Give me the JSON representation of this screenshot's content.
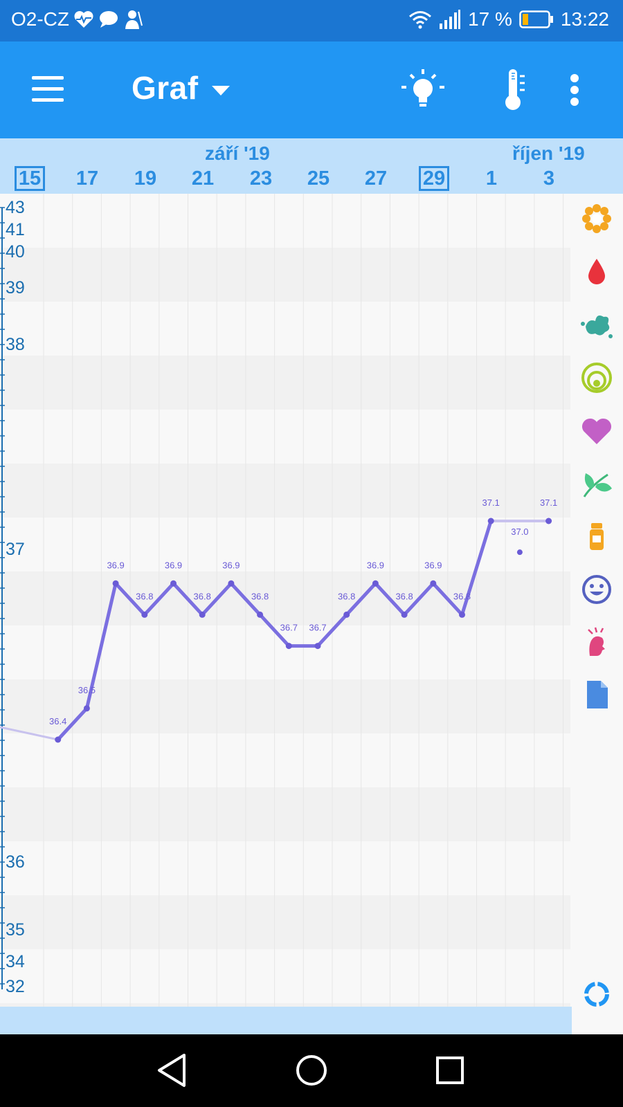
{
  "status_bar": {
    "carrier": "O2-CZ",
    "battery_percent": "17 %",
    "time": "13:22",
    "icons": [
      "heart-pulse-icon",
      "chat-icon",
      "doctor-icon",
      "wifi-icon",
      "signal-icon",
      "battery-icon"
    ]
  },
  "app_bar": {
    "title": "Graf",
    "icons": [
      "menu-icon",
      "dropdown-caret-icon",
      "lightbulb-icon",
      "thermometer-icon",
      "more-vert-icon"
    ]
  },
  "date_header": {
    "months": [
      "září '19",
      "říjen '19"
    ],
    "days": [
      "15",
      "17",
      "19",
      "21",
      "23",
      "25",
      "27",
      "29",
      "1",
      "3"
    ],
    "boxed_days": [
      "15",
      "29"
    ]
  },
  "chart_data": {
    "type": "line",
    "ylabel": "",
    "y_tick_labels": [
      "43",
      "41",
      "40",
      "39",
      "38",
      "37",
      "36",
      "35",
      "34",
      "32"
    ],
    "x_tick_labels": [
      "15",
      "17",
      "19",
      "21",
      "23",
      "25",
      "27",
      "29",
      "1",
      "3"
    ],
    "series": [
      {
        "values_by_day": [
          {
            "day": "16",
            "value": 36.4
          },
          {
            "day": "17",
            "value": 36.5
          },
          {
            "day": "18",
            "value": 36.9
          },
          {
            "day": "19",
            "value": 36.8
          },
          {
            "day": "20",
            "value": 36.9
          },
          {
            "day": "21",
            "value": 36.8
          },
          {
            "day": "22",
            "value": 36.9
          },
          {
            "day": "23",
            "value": 36.8
          },
          {
            "day": "24",
            "value": 36.7
          },
          {
            "day": "25",
            "value": 36.7
          },
          {
            "day": "26",
            "value": 36.8
          },
          {
            "day": "27",
            "value": 36.9
          },
          {
            "day": "28",
            "value": 36.8
          },
          {
            "day": "29",
            "value": 36.9
          },
          {
            "day": "30",
            "value": 36.8
          },
          {
            "day": "1",
            "value": 37.1
          },
          {
            "day": "3",
            "value": 37.1
          }
        ],
        "labels": [
          "36.4",
          "36.5",
          "36.9",
          "36.8",
          "36.9",
          "36.8",
          "36.9",
          "36.8",
          "36.7",
          "36.7",
          "36.8",
          "36.9",
          "36.8",
          "36.9",
          "36.8",
          "37.1",
          "37.1"
        ]
      }
    ],
    "excluded_points": [
      {
        "day": "2",
        "value": 37.0,
        "label": "37.0"
      }
    ],
    "colors": {
      "line": "#7b6fe0",
      "point": "#6a5bd6"
    }
  },
  "side_icons": [
    "flower-icon",
    "blood-drop-icon",
    "splash-icon",
    "cervix-icon",
    "heart-icon",
    "leaf-icon",
    "pill-bottle-icon",
    "smiley-icon",
    "head-pain-icon",
    "document-icon",
    "sync-icon"
  ],
  "nav_bar": {
    "icons": [
      "back-icon",
      "home-icon",
      "recents-icon"
    ]
  },
  "colors": {
    "status_bar": "#1b76d2",
    "app_bar": "#2196f3",
    "date_bar": "#bfe0fb",
    "accent": "#2b8de0"
  }
}
